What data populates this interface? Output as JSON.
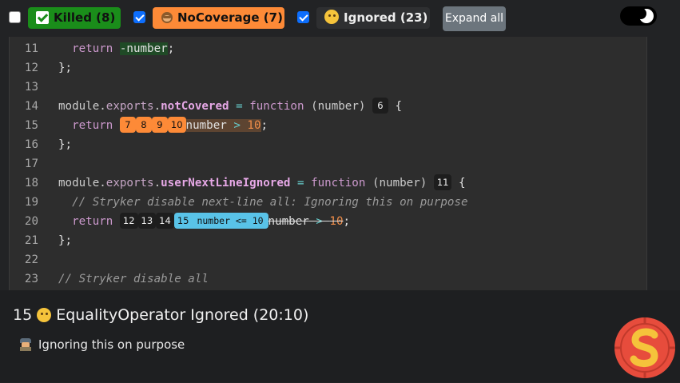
{
  "toolbar": {
    "killed": {
      "label": "Killed (8)",
      "checked": false
    },
    "no_coverage": {
      "label": "NoCoverage (7)",
      "checked": true
    },
    "ignored": {
      "label": "Ignored (23)",
      "checked": true
    },
    "expand_all": "Expand all",
    "theme_toggle": "dark"
  },
  "code": {
    "lines": [
      {
        "n": "11"
      },
      {
        "n": "12"
      },
      {
        "n": "13"
      },
      {
        "n": "14"
      },
      {
        "n": "15"
      },
      {
        "n": "16"
      },
      {
        "n": "17"
      },
      {
        "n": "18"
      },
      {
        "n": "19"
      },
      {
        "n": "20"
      },
      {
        "n": "21"
      },
      {
        "n": "22"
      },
      {
        "n": "23"
      }
    ],
    "l11": {
      "kw": "return",
      "mut": "-number",
      "end": ";"
    },
    "l12": "};",
    "l14": {
      "a": "module",
      "b": ".",
      "c": "exports",
      "d": ".",
      "e": "notCovered",
      "f": " = ",
      "g": "function",
      "h": " (number) ",
      "chip": "6",
      "i": " {"
    },
    "l15": {
      "kw": "return",
      "chips": [
        "7",
        "8",
        "9",
        "10"
      ],
      "v": "number",
      "op": " > ",
      "num": "10",
      "end": ";"
    },
    "l16": "};",
    "l18": {
      "a": "module",
      "b": ".",
      "c": "exports",
      "d": ".",
      "e": "userNextLineIgnored",
      "f": " = ",
      "g": "function",
      "h": " (number) ",
      "chip": "11",
      "i": " {"
    },
    "l19": "// Stryker disable next-line all: Ignoring this on purpose",
    "l20": {
      "kw": "return",
      "chips": [
        "12",
        "13",
        "14"
      ],
      "sel_chip": "15",
      "repl": "number <= 10",
      "v": "number",
      "op": " > ",
      "num": "10",
      "end": ";"
    },
    "l21": "};",
    "l23": "// Stryker disable all"
  },
  "panel": {
    "id": "15",
    "title": "EqualityOperator Ignored (20:10)",
    "description": "Ignoring this on purpose"
  },
  "colors": {
    "killed": "#1a8d1a",
    "no_coverage": "#fd8a37",
    "ignored_chip": "#59c3e8",
    "logo_red": "#e74c3c",
    "logo_yellow": "#f5c33b"
  }
}
